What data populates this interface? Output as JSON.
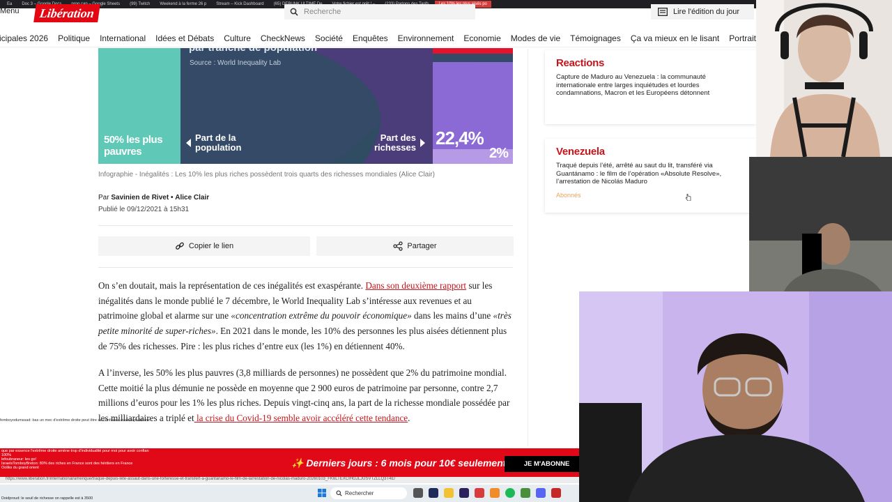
{
  "browser_tabs": [
    {
      "label": "Ea"
    },
    {
      "label": "Doc 3 – Google Docs"
    },
    {
      "label": "prog cap – Google Sheets"
    },
    {
      "label": "(99) Twitch"
    },
    {
      "label": "Weekend à la ferme 26 p"
    },
    {
      "label": "Stream – Kick Dashboard"
    },
    {
      "label": "(65) DEBUNK ULTIME De"
    },
    {
      "label": "Votre fichier est prêt ! –"
    },
    {
      "label": "(233) Parlons des Tarifs"
    },
    {
      "label": "Les 10% les plus aisés po",
      "active": true
    }
  ],
  "header": {
    "menu_label": "Menu",
    "logo_text": "Libération",
    "search_placeholder": "Recherche",
    "read_edition_label": "Lire l'édition du jour"
  },
  "nav": {
    "items": [
      "icipales 2026",
      "Politique",
      "International",
      "Idées et Débats",
      "Culture",
      "CheckNews",
      "Société",
      "Enquêtes",
      "Environnement",
      "Economie",
      "Modes de vie",
      "Témoignages",
      "Ça va mieux en le lisant",
      "Portraits"
    ]
  },
  "article": {
    "infographic": {
      "title_fragment": "par tranche de population",
      "source": "Source : World Inequality Lab",
      "poor_label": "50% les plus pauvres",
      "population_label": "Part de la population",
      "wealth_label": "Part des richesses",
      "value_top": "22,4%",
      "value_bottom": "2%"
    },
    "caption": "Infographie - Inégalités : Les 10% les plus riches possèdent trois quarts des richesses mondiales (Alice Clair)",
    "byline_prefix": "Par",
    "author_1": "Savinien de Rivet",
    "byline_sep": "•",
    "author_2": "Alice Clair",
    "published": "Publié le 09/12/2021 à 15h31",
    "copy_link_label": "Copier le lien",
    "share_label": "Partager",
    "p1": {
      "a": "On s’en doutait, mais la représentation de ces inégalités est exaspérante. ",
      "link": "Dans son deuxième rapport",
      "b": " sur les inégalités dans le monde publié le 7 décembre, le World Inequality Lab s’intéresse aux revenues et au patrimoine global et alarme sur une ",
      "i1": "«concentration extrême du pouvoir économique»",
      "c": " dans les mains d’une ",
      "i2": "«très petite minorité de super-riches»",
      "d": ". En 2021 dans le monde, les 10% des personnes les plus aisées détiennent plus de 75% des richesses. Pire : les plus riches d’entre eux (les 1%) en détiennent 40%."
    },
    "p2": {
      "a": "A l’inverse, les 50% les plus pauvres (3,8 milliards de personnes) ne possèdent que 2% du patrimoine mondial. Cette moitié la plus démunie ne possède en moyenne que 2 900 euros de patrimoine par personne, contre 2,7 millions d’euros pour les 1% les plus riches. Depuis vingt-cinq ans, la part de la richesse mondiale possédée par les milliardaires a triplé et",
      "link": " la crise du Covid-19 semble avoir accéléré cette tendance",
      "b": "."
    }
  },
  "sidebar": {
    "card1": {
      "kicker": "Reactions",
      "text": "Capture de Maduro au Venezuela : la communauté internationale entre larges inquiétudes et lourdes condamnations, Macron et les Européens détonnent"
    },
    "card2": {
      "kicker": "Venezuela",
      "text": "Traqué depuis l’été, arrêté au saut du lit, transféré via Guantánamo : le film de l’opération «Absolute Resolve», l’arrestation de Nicolás Maduro",
      "badge": "Abonnés"
    }
  },
  "promo": {
    "text": "✨ Derniers jours : 6 mois pour 10€ seulement !",
    "button": "JE M'ABONNE"
  },
  "status_url": "https://www.liberation.fr/international/amerique/traque-depuis-lete-assaut-dans-une-forteresse-et-transfert-a-guantanamo-le-film-de-larrestation-de-nicolas-maduro-20260103_FK6LTEXCIHGJLJUSVTZLLQ3T4E/",
  "chat": [
    {
      "text": "femboyodumssad: bas un mec d'extrême droite peut être de confiance mais le problème"
    },
    {
      "text": "que par essence l'extrême droite amène trop d'individualité pour moi pour avoir confian"
    },
    {
      "text": "100%"
    },
    {
      "text": "lefoubraneur: les go!"
    },
    {
      "text": "IsraelsTomboyBreton: 80% des riches en France sont des héritiers en France"
    },
    {
      "text": "Ooliks du grand orient"
    },
    {
      "text": "Doidproud: le seuil de richesse on rappelle est à 3500"
    }
  ],
  "taskbar": {
    "search_label": "Rechercher"
  },
  "colors": {
    "brand_red": "#e30613",
    "link_red": "#c4161c",
    "promo_red": "#e10918"
  }
}
